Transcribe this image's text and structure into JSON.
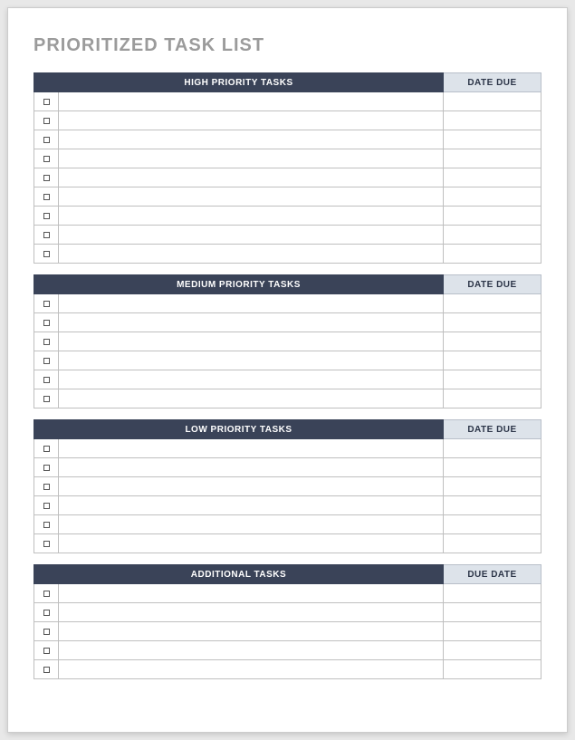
{
  "title": "PRIORITIZED TASK LIST",
  "sections": [
    {
      "header_tasks": "HIGH PRIORITY TASKS",
      "header_date": "DATE DUE",
      "rows": [
        {
          "task": "",
          "date": ""
        },
        {
          "task": "",
          "date": ""
        },
        {
          "task": "",
          "date": ""
        },
        {
          "task": "",
          "date": ""
        },
        {
          "task": "",
          "date": ""
        },
        {
          "task": "",
          "date": ""
        },
        {
          "task": "",
          "date": ""
        },
        {
          "task": "",
          "date": ""
        },
        {
          "task": "",
          "date": ""
        }
      ]
    },
    {
      "header_tasks": "MEDIUM PRIORITY TASKS",
      "header_date": "DATE DUE",
      "rows": [
        {
          "task": "",
          "date": ""
        },
        {
          "task": "",
          "date": ""
        },
        {
          "task": "",
          "date": ""
        },
        {
          "task": "",
          "date": ""
        },
        {
          "task": "",
          "date": ""
        },
        {
          "task": "",
          "date": ""
        }
      ]
    },
    {
      "header_tasks": "LOW PRIORITY TASKS",
      "header_date": "DATE DUE",
      "rows": [
        {
          "task": "",
          "date": ""
        },
        {
          "task": "",
          "date": ""
        },
        {
          "task": "",
          "date": ""
        },
        {
          "task": "",
          "date": ""
        },
        {
          "task": "",
          "date": ""
        },
        {
          "task": "",
          "date": ""
        }
      ]
    },
    {
      "header_tasks": "ADDITIONAL TASKS",
      "header_date": "DUE DATE",
      "rows": [
        {
          "task": "",
          "date": ""
        },
        {
          "task": "",
          "date": ""
        },
        {
          "task": "",
          "date": ""
        },
        {
          "task": "",
          "date": ""
        },
        {
          "task": "",
          "date": ""
        }
      ]
    }
  ]
}
